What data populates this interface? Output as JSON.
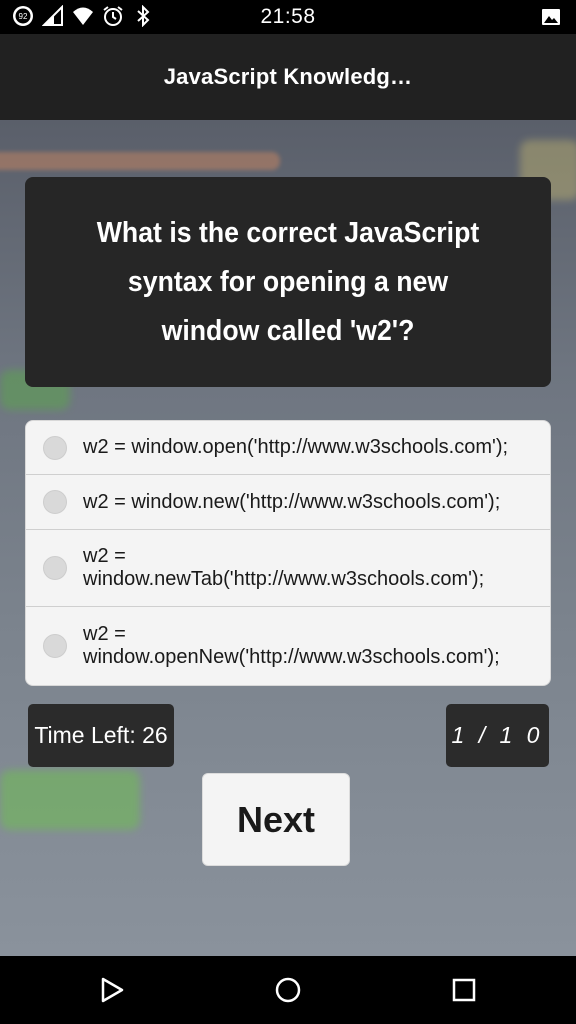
{
  "status_bar": {
    "notification_badge": "92",
    "time": "21:58"
  },
  "app_bar": {
    "title": "JavaScript Knowledg…"
  },
  "quiz": {
    "question": "What is the correct JavaScript syntax for opening a new window called 'w2'?",
    "options": [
      {
        "label": "w2 = window.open('http://www.w3schools.com');",
        "selected": false
      },
      {
        "label": "w2 = window.new('http://www.w3schools.com');",
        "selected": false
      },
      {
        "label": "w2 =\nwindow.newTab('http://www.w3schools.com');",
        "selected": false
      },
      {
        "label": "w2 =\nwindow.openNew('http://www.w3schools.com');",
        "selected": false
      }
    ],
    "time_left": "Time Left: 26",
    "progress": "1 / 1 0",
    "next_label": "Next"
  },
  "colors": {
    "app_bar": "#212121",
    "card": "#262626",
    "option_bg": "#f4f4f4",
    "badge": "#2b2b2b"
  },
  "icons": {
    "status_left": [
      "notification-count-icon",
      "signal-icon",
      "wifi-icon",
      "alarm-icon",
      "bluetooth-icon"
    ],
    "status_right": [
      "image-icon"
    ],
    "nav": [
      "back-icon",
      "home-icon",
      "recents-icon"
    ]
  }
}
